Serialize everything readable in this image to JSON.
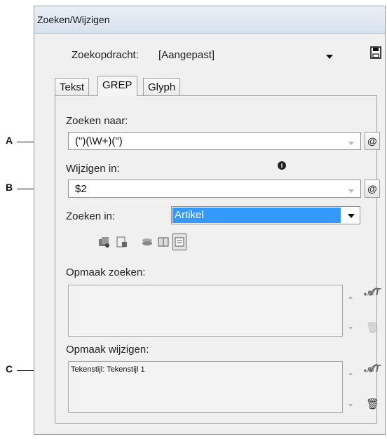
{
  "window": {
    "title": "Zoeken/Wijzigen"
  },
  "query": {
    "label": "Zoekopdracht:",
    "value": "[Aangepast]",
    "save_icon": "floppy-disk-icon"
  },
  "tabs": [
    {
      "label": "Tekst",
      "active": false
    },
    {
      "label": "GREP",
      "active": true
    },
    {
      "label": "Glyph",
      "active": false
    }
  ],
  "find": {
    "label": "Zoeken naar:",
    "value": "(\")(\\W+)(\")"
  },
  "change": {
    "label": "Wijzigen in:",
    "value": "$2",
    "info_icon": "info-icon"
  },
  "search_in": {
    "label": "Zoeken in:",
    "value": "Artikel"
  },
  "scope_icons": [
    "all-documents-icon",
    "document-icon",
    "layers-icon",
    "story-icon",
    "selection-icon"
  ],
  "find_format": {
    "label": "Opmaak zoeken:",
    "content": ""
  },
  "change_format": {
    "label": "Opmaak wijzigen:",
    "content": "Tekenstijl: Tekenstijl 1"
  },
  "callouts": [
    "A",
    "B",
    "C"
  ],
  "colors": {
    "selection": "#3399ff",
    "titlebar": "#dbe5ef"
  }
}
